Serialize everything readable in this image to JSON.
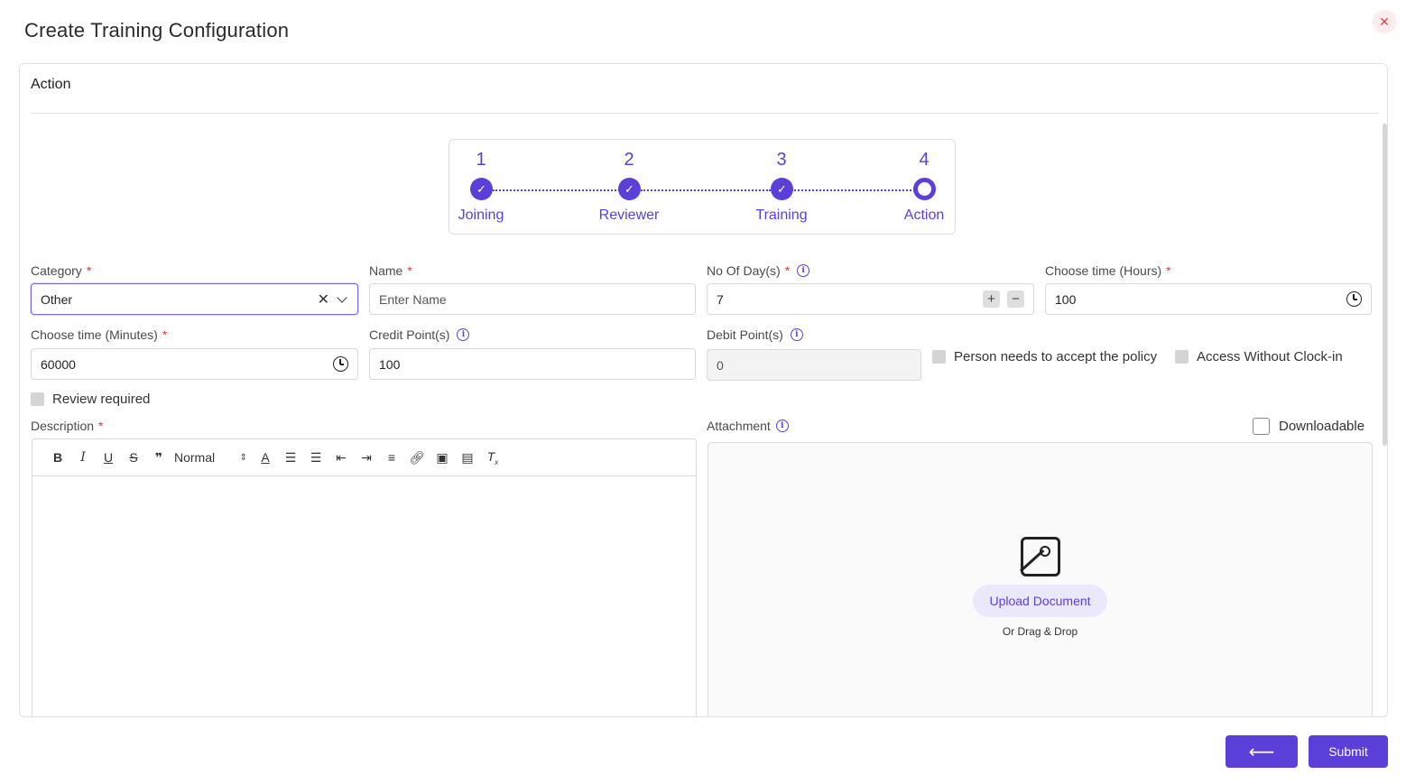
{
  "modal": {
    "title": "Create Training Configuration",
    "close_symbol": "✕"
  },
  "section": {
    "title": "Action"
  },
  "stepper": {
    "steps": [
      {
        "number": "1",
        "label": "Joining",
        "state": "completed"
      },
      {
        "number": "2",
        "label": "Reviewer",
        "state": "completed"
      },
      {
        "number": "3",
        "label": "Training",
        "state": "completed"
      },
      {
        "number": "4",
        "label": "Action",
        "state": "current"
      }
    ],
    "check_symbol": "✓"
  },
  "form": {
    "category": {
      "label": "Category",
      "required": "*",
      "value": "Other",
      "clear_symbol": "✕"
    },
    "name": {
      "label": "Name",
      "required": "*",
      "placeholder": "Enter Name",
      "value": ""
    },
    "days": {
      "label": "No Of Day(s)",
      "required": "*",
      "value": "7",
      "plus": "+",
      "minus": "−"
    },
    "hours": {
      "label": "Choose time (Hours)",
      "required": "*",
      "value": "100"
    },
    "minutes": {
      "label": "Choose time (Minutes)",
      "required": "*",
      "value": "60000"
    },
    "credit": {
      "label": "Credit Point(s)",
      "value": "100"
    },
    "debit": {
      "label": "Debit Point(s)",
      "value": "0"
    },
    "accept_policy": {
      "label": "Person needs to accept the policy",
      "checked": false
    },
    "access_without_clockin": {
      "label": "Access Without Clock-in",
      "checked": false
    },
    "review_required": {
      "label": "Review required",
      "checked": false
    },
    "description": {
      "label": "Description",
      "required": "*",
      "heading_select": "Normal",
      "value": ""
    },
    "attachment": {
      "label": "Attachment",
      "downloadable_label": "Downloadable",
      "downloadable_checked": false,
      "upload_label": "Upload Document",
      "drag_text": "Or Drag & Drop"
    }
  },
  "info_symbol": "i",
  "footer": {
    "back_symbol": "⟵",
    "submit_label": "Submit"
  },
  "colors": {
    "accent": "#5b3fd8",
    "required": "#e03a3a",
    "close_bg": "#fdecec"
  }
}
